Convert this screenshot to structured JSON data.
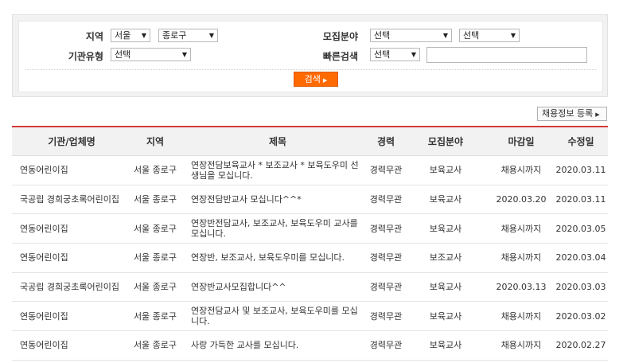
{
  "search": {
    "region_label": "지역",
    "region_city": "서울",
    "region_district": "종로구",
    "field_label": "모집분야",
    "field_select1": "선택",
    "field_select2": "선택",
    "org_type_label": "기관유형",
    "org_type_select": "선택",
    "quick_label": "빠른검색",
    "quick_select": "선택",
    "quick_input_value": "",
    "search_button": "검색"
  },
  "register_button": "채용정보 등록",
  "table": {
    "headers": [
      "기관/업체명",
      "지역",
      "제목",
      "경력",
      "모집분야",
      "마감일",
      "수정일"
    ],
    "rows": [
      {
        "org": "연동어린이집",
        "region": "서울 종로구",
        "title": "연장전담보육교사 * 보조교사 * 보육도우미 선생님을 모십니다.",
        "exp": "경력무관",
        "field": "보육교사",
        "deadline": "채용시까지",
        "modified": "2020.03.11"
      },
      {
        "org": "국공립 경희궁초록어린이집",
        "region": "서울 종로구",
        "title": "연장전담반교사 모십니다^^*",
        "exp": "경력무관",
        "field": "보육교사",
        "deadline": "2020.03.20",
        "modified": "2020.03.11"
      },
      {
        "org": "연동어린이집",
        "region": "서울 종로구",
        "title": "연장반전담교사, 보조교사, 보육도우미 교사를 모십니다.",
        "exp": "경력무관",
        "field": "보육교사",
        "deadline": "채용시까지",
        "modified": "2020.03.05"
      },
      {
        "org": "연동어린이집",
        "region": "서울 종로구",
        "title": "연장반, 보조교사, 보육도우미를 모십니다.",
        "exp": "경력무관",
        "field": "보조교사",
        "deadline": "채용시까지",
        "modified": "2020.03.04"
      },
      {
        "org": "국공립 경희궁초록어린이집",
        "region": "서울 종로구",
        "title": "연장반교사모집합니다^^",
        "exp": "경력무관",
        "field": "보육교사",
        "deadline": "2020.03.13",
        "modified": "2020.03.03"
      },
      {
        "org": "연동어린이집",
        "region": "서울 종로구",
        "title": "연장전담교사 및 보조교사, 보육도우미를 모십니다.",
        "exp": "경력무관",
        "field": "보육교사",
        "deadline": "채용시까지",
        "modified": "2020.03.02"
      },
      {
        "org": "연동어린이집",
        "region": "서울 종로구",
        "title": "사랑 가득한 교사를 모십니다.",
        "exp": "경력무관",
        "field": "보육교사",
        "deadline": "채용시까지",
        "modified": "2020.02.27"
      }
    ]
  }
}
